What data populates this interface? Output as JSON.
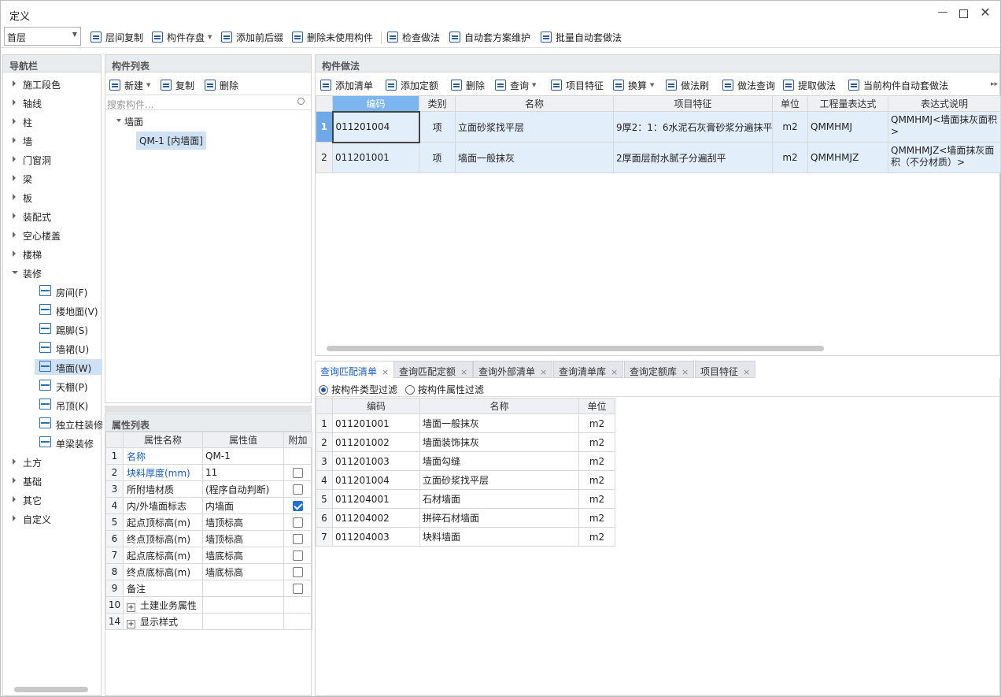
{
  "window": {
    "title": "定义"
  },
  "toolbar": {
    "floor_select": "首层",
    "buttons": [
      "层间复制",
      "构件存盘",
      "添加前后缀",
      "删除未使用构件",
      "检查做法",
      "自动套方案维护",
      "批量自动套做法"
    ]
  },
  "nav": {
    "header": "导航栏",
    "items": [
      "施工段色",
      "轴线",
      "柱",
      "墙",
      "门窗洞",
      "梁",
      "板",
      "装配式",
      "空心楼盖",
      "楼梯",
      "装修"
    ],
    "sub_items": [
      "房间(F)",
      "楼地面(V)",
      "踢脚(S)",
      "墙裙(U)",
      "墙面(W)",
      "天棚(P)",
      "吊顶(K)",
      "独立柱装修",
      "单梁装修"
    ],
    "items_after": [
      "土方",
      "基础",
      "其它",
      "自定义"
    ]
  },
  "component_list": {
    "header": "构件列表",
    "buttons": [
      "新建",
      "复制",
      "删除"
    ],
    "search_placeholder": "搜索构件...",
    "tree_group": "墙面",
    "tree_item": "QM-1 [内墙面]"
  },
  "property_list": {
    "header": "属性列表",
    "columns": [
      "属性名称",
      "属性值",
      "附加"
    ],
    "rows": [
      {
        "no": "1",
        "name": "名称",
        "value": "QM-1",
        "check": null,
        "blue": true
      },
      {
        "no": "2",
        "name": "块料厚度(mm)",
        "value": "11",
        "check": false,
        "blue": true
      },
      {
        "no": "3",
        "name": "所附墙材质",
        "value": "(程序自动判断)",
        "check": false,
        "blue": false
      },
      {
        "no": "4",
        "name": "内/外墙面标志",
        "value": "内墙面",
        "check": true,
        "blue": false
      },
      {
        "no": "5",
        "name": "起点顶标高(m)",
        "value": "墙顶标高",
        "check": false,
        "blue": false
      },
      {
        "no": "6",
        "name": "终点顶标高(m)",
        "value": "墙顶标高",
        "check": false,
        "blue": false
      },
      {
        "no": "7",
        "name": "起点底标高(m)",
        "value": "墙底标高",
        "check": false,
        "blue": false
      },
      {
        "no": "8",
        "name": "终点底标高(m)",
        "value": "墙底标高",
        "check": false,
        "blue": false
      },
      {
        "no": "9",
        "name": "备注",
        "value": "",
        "check": false,
        "blue": false
      },
      {
        "no": "10",
        "name": "土建业务属性",
        "value": "",
        "check": null,
        "blue": false,
        "expand": true
      },
      {
        "no": "14",
        "name": "显示样式",
        "value": "",
        "check": null,
        "blue": false,
        "expand": true
      }
    ]
  },
  "method": {
    "header": "构件做法",
    "buttons": [
      "添加清单",
      "添加定额",
      "删除",
      "查询",
      "项目特征",
      "换算",
      "做法刷",
      "做法查询",
      "提取做法",
      "当前构件自动套做法"
    ],
    "columns": [
      "编码",
      "类别",
      "名称",
      "项目特征",
      "单位",
      "工程量表达式",
      "表达式说明"
    ],
    "rows": [
      {
        "no": "1",
        "code": "011201004",
        "type": "项",
        "name": "立面砂浆找平层",
        "feature": "9厚2：1：6水泥石灰膏砂浆分遍抹平",
        "unit": "m2",
        "expr": "QMMHMJ",
        "desc1": "QMMHMJ<墙面抹灰面积",
        "desc2": ">"
      },
      {
        "no": "2",
        "code": "011201001",
        "type": "项",
        "name": "墙面一般抹灰",
        "feature": "2厚面层耐水腻子分遍刮平",
        "unit": "m2",
        "expr": "QMMHMJZ",
        "desc1": "QMMHMJZ<墙面抹灰面",
        "desc2": "积（不分材质）>"
      }
    ]
  },
  "query": {
    "tabs": [
      "查询匹配清单",
      "查询匹配定额",
      "查询外部清单",
      "查询清单库",
      "查询定额库",
      "项目特征"
    ],
    "filters": [
      "按构件类型过滤",
      "按构件属性过滤"
    ],
    "columns": [
      "编码",
      "名称",
      "单位"
    ],
    "rows": [
      {
        "no": "1",
        "code": "011201001",
        "name": "墙面一般抹灰",
        "unit": "m2"
      },
      {
        "no": "2",
        "code": "011201002",
        "name": "墙面装饰抹灰",
        "unit": "m2"
      },
      {
        "no": "3",
        "code": "011201003",
        "name": "墙面勾缝",
        "unit": "m2"
      },
      {
        "no": "4",
        "code": "011201004",
        "name": "立面砂浆找平层",
        "unit": "m2"
      },
      {
        "no": "5",
        "code": "011204001",
        "name": "石材墙面",
        "unit": "m2"
      },
      {
        "no": "6",
        "code": "011204002",
        "name": "拼碎石材墙面",
        "unit": "m2"
      },
      {
        "no": "7",
        "code": "011204003",
        "name": "块料墙面",
        "unit": "m2"
      }
    ]
  }
}
